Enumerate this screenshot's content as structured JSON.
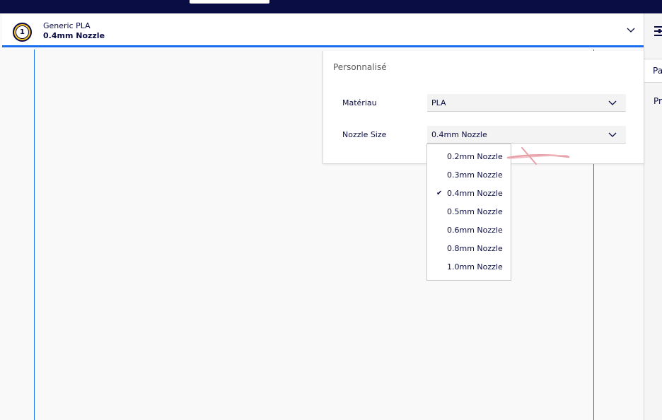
{
  "header": {
    "extruder_number": "1",
    "material": "Generic PLA",
    "nozzle": "0.4mm Nozzle"
  },
  "right_panel": {
    "tab_label": "Pa",
    "text_label": "Pr"
  },
  "popup": {
    "title": "Personnalisé",
    "material_label": "Matériau",
    "material_value": "PLA",
    "nozzle_label": "Nozzle Size",
    "nozzle_value": "0.4mm Nozzle"
  },
  "dropdown": {
    "options": [
      {
        "label": "0.2mm Nozzle",
        "selected": false
      },
      {
        "label": "0.3mm Nozzle",
        "selected": false
      },
      {
        "label": "0.4mm Nozzle",
        "selected": true
      },
      {
        "label": "0.5mm Nozzle",
        "selected": false
      },
      {
        "label": "0.6mm Nozzle",
        "selected": false
      },
      {
        "label": "0.8mm Nozzle",
        "selected": false
      },
      {
        "label": "1.0mm Nozzle",
        "selected": false
      }
    ],
    "check_mark": "✔"
  },
  "colors": {
    "accent_blue": "#196ef0",
    "dark_navy": "#0a0c44",
    "badge_yellow": "#ffc924",
    "annotation_red": "#e8a0a8"
  },
  "icons": {
    "extruder": "extruder-badge-icon",
    "chevron": "chevron-down-icon",
    "settings": "settings-sliders-icon",
    "check": "check-icon"
  }
}
